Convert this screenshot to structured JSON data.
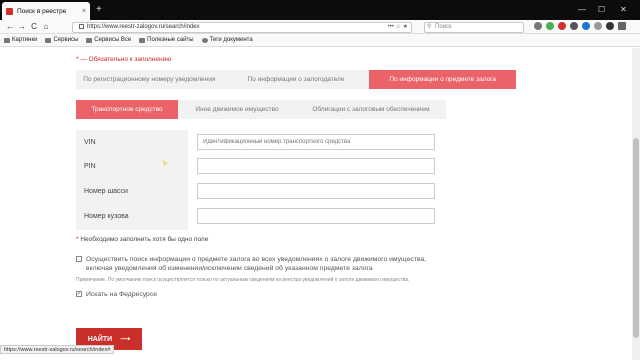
{
  "browser": {
    "tab_title": "Поиск в реестре",
    "tab_close": "×",
    "new_tab": "+",
    "win_min": "—",
    "win_max": "☐",
    "win_close": "✕",
    "back": "←",
    "forward": "→",
    "reload": "C",
    "home": "⌂",
    "url": "https://www.reestr-zalogov.ru/search/index",
    "url_icons": "••• ☆ ★",
    "search_placeholder": "Поиск",
    "bookmarks": [
      "Картинки",
      "Сервисы",
      "Сервисы Все",
      "Полезные сайты",
      "Теги документа"
    ]
  },
  "page": {
    "required_note": "* — Обязательно к заполнению",
    "search_tabs": [
      {
        "label": "По регистрационному номеру уведомления",
        "active": false
      },
      {
        "label": "По информации о залогодателе",
        "active": false
      },
      {
        "label": "По информации о предмете залога",
        "active": true
      }
    ],
    "property_tabs": [
      {
        "label": "Транспортное средство",
        "active": true
      },
      {
        "label": "Иное движимое имущество",
        "active": false
      },
      {
        "label": "Облигации с залоговым обеспечением",
        "active": false
      }
    ],
    "fields": [
      {
        "label": "VIN",
        "placeholder": "Идентификационный номер транспортного средства"
      },
      {
        "label": "PIN",
        "placeholder": ""
      },
      {
        "label": "Номер шасси",
        "placeholder": ""
      },
      {
        "label": "Номер кузова",
        "placeholder": ""
      }
    ],
    "required_one": "Необходимо заполнить хотя бы одно поле",
    "required_star": "*",
    "checkbox_all": "Осуществить поиск информации о предмете залога во всех уведомлениях о залоге движимого имущества, включая уведомления об изменении/исключении сведений об указанном предмете залога",
    "checkbox_all_note": "Примечание. По умолчанию поиск осуществляется только по актуальным сведениям из реестра уведомлений о залоге движимого имущества.",
    "checkbox_fedresurs": "Искать на Федресурсе",
    "checkbox_fedresurs_mark": "✓",
    "find_button": "НАЙТИ",
    "find_arrow": "⟶",
    "status_url": "https://www.reestr-zalogov.ru/search/index#"
  }
}
